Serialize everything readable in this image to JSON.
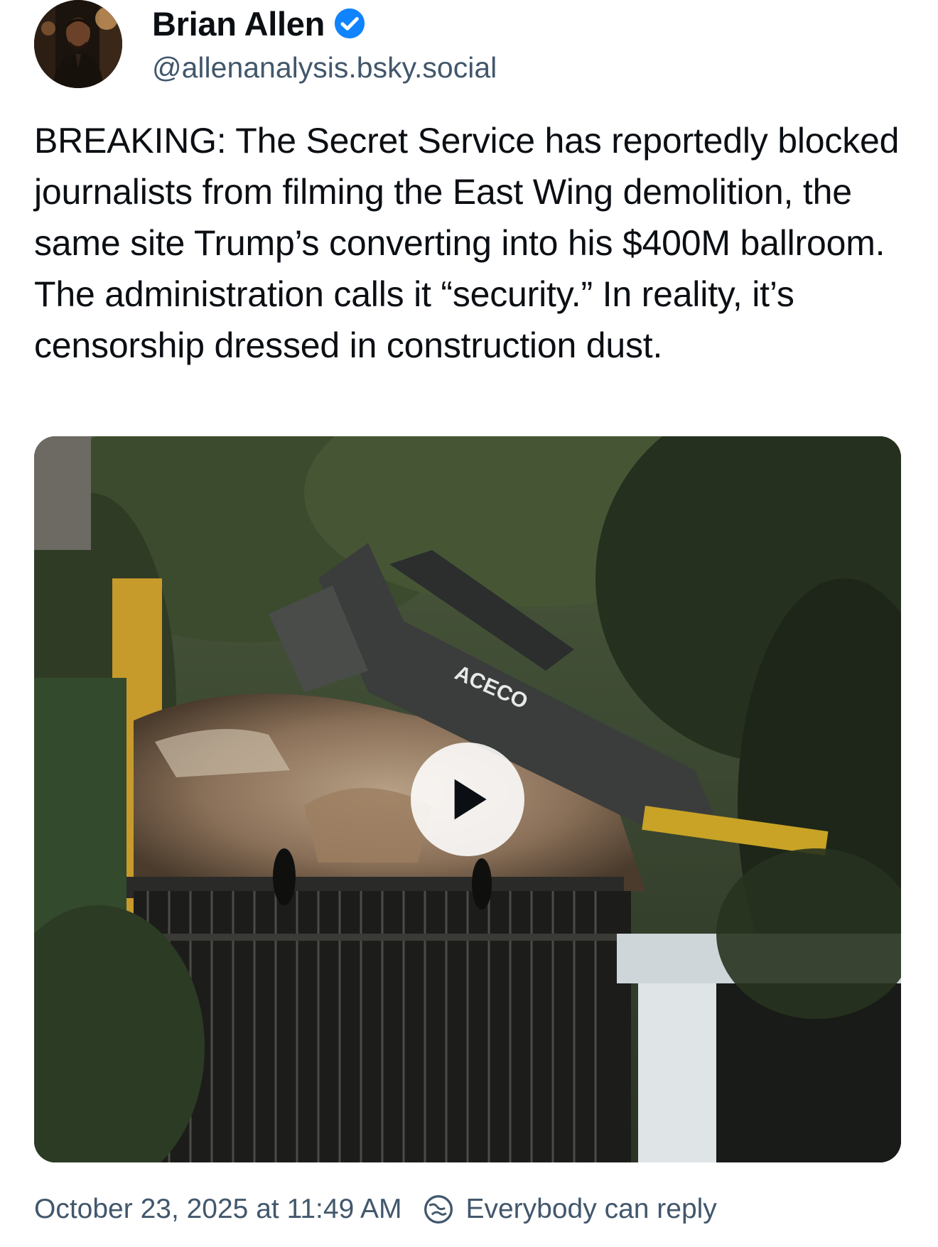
{
  "author": {
    "display_name": "Brian Allen",
    "handle": "@allenanalysis.bsky.social",
    "verified": true,
    "avatar_icon": "avatar-photo",
    "verified_icon": "verified-check-icon"
  },
  "post": {
    "text": "BREAKING: The Secret Service has reportedly blocked journalists from filming the East Wing demolition, the same site Trump’s converting into his $400M ballroom. The administration calls it “security.” In reality, it’s censorship dressed in construction dust."
  },
  "media": {
    "type": "video",
    "overlay_text": "ACECO",
    "play_icon": "play-icon"
  },
  "footer": {
    "timestamp": "October 23, 2025 at 11:49 AM",
    "reply_setting": "Everybody can reply",
    "reply_icon": "reply-settings-icon"
  },
  "colors": {
    "verified_blue": "#1083fe",
    "secondary_text": "#42576c",
    "primary_text": "#0b0f14"
  }
}
